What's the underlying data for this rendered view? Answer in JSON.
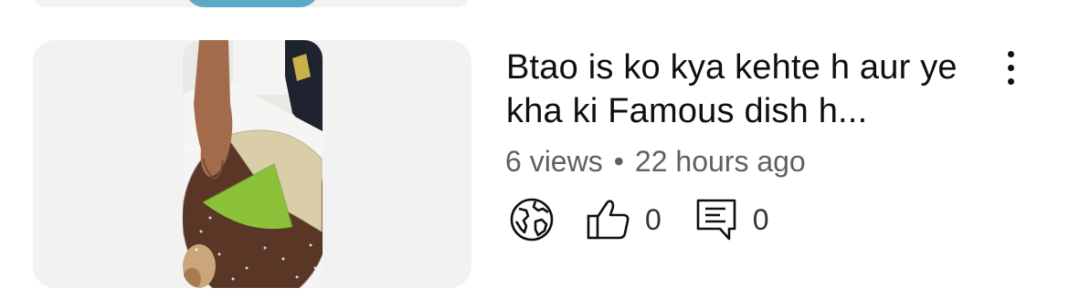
{
  "video": {
    "title": "Btao is ko kya kehte h aur ye kha ki Famous dish h...",
    "views": "6 views",
    "separator": "•",
    "age": "22 hours ago",
    "likes": "0",
    "comments": "0"
  },
  "icons": {
    "visibility": "globe-icon",
    "like": "thumbs-up-icon",
    "comment": "comment-icon",
    "more": "more-vert-icon",
    "shorts": "shorts-logo-icon"
  },
  "colors": {
    "text_primary": "#0f0f0f",
    "text_secondary": "#606060",
    "card_background": "#f2f2f2"
  }
}
